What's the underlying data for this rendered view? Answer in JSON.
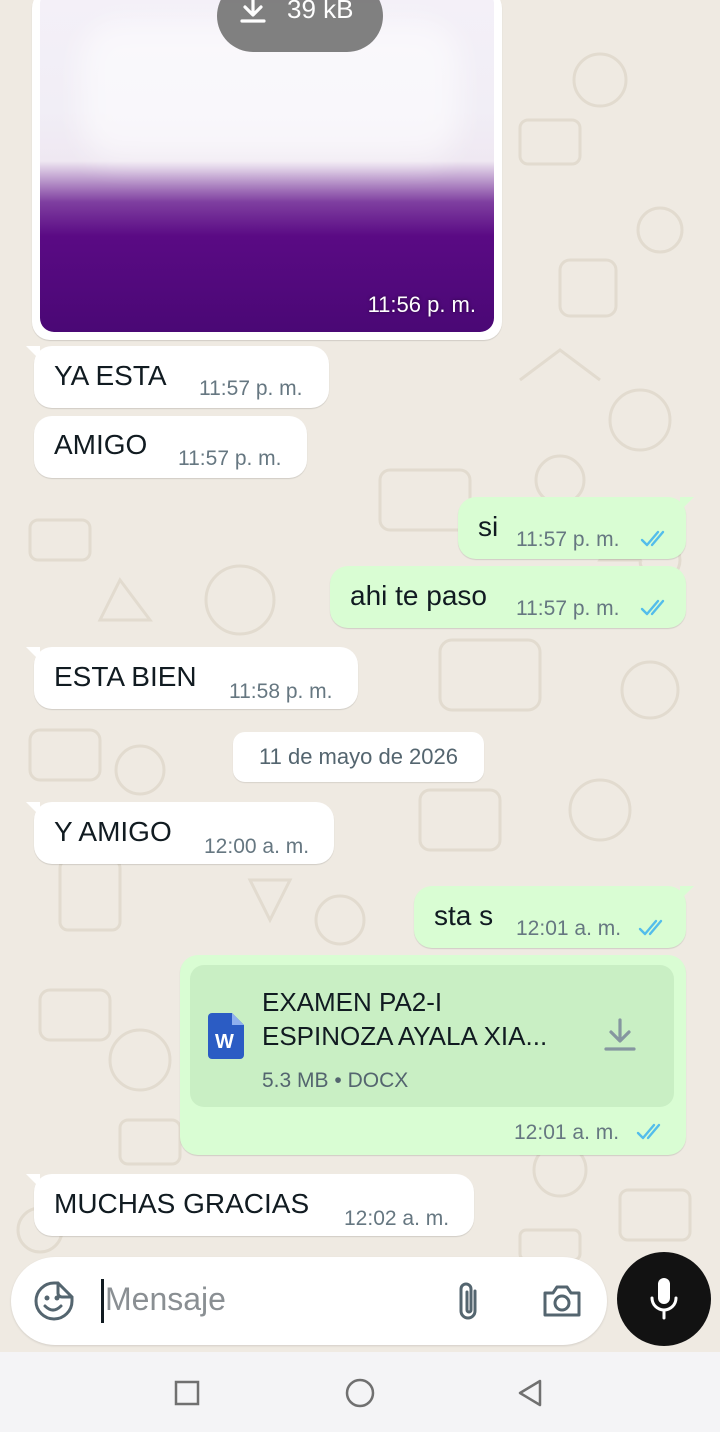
{
  "image_message": {
    "size": "39 kB",
    "time": "11:56 p. m."
  },
  "messages": [
    {
      "text": "YA ESTA",
      "time": "11:57 p. m."
    },
    {
      "text": "AMIGO",
      "time": "11:57 p. m."
    },
    {
      "text": "si",
      "time": "11:57 p. m."
    },
    {
      "text": "ahi te paso",
      "time": "11:57 p. m."
    },
    {
      "text": "ESTA BIEN",
      "time": "11:58 p. m."
    },
    {
      "text": "Y AMIGO",
      "time": "12:00 a. m."
    },
    {
      "text": "sta s",
      "time": "12:01 a. m."
    },
    {
      "text": "MUCHAS GRACIAS",
      "time": "12:02 a. m."
    }
  ],
  "date_separator": "11 de mayo de 2026",
  "document": {
    "title_line1": "EXAMEN PA2-I",
    "title_line2": "ESPINOZA AYALA XIA...",
    "size": "5.3 MB",
    "type": "DOCX",
    "icon_letter": "W",
    "time": "12:01 a. m."
  },
  "input": {
    "placeholder": "Mensaje"
  },
  "icons": {
    "sticker": "sticker-icon",
    "attach": "paperclip-icon",
    "camera": "camera-icon",
    "mic": "microphone-icon",
    "read": "double-check-icon",
    "download": "download-icon",
    "word": "word-document-icon",
    "nav": [
      "recents-square-icon",
      "home-circle-icon",
      "back-triangle-icon"
    ]
  },
  "colors": {
    "chat_background": "#efeae2",
    "incoming_bubble": "#ffffff",
    "outgoing_bubble": "#d9fdd3",
    "read_ticks": "#53bdeb",
    "word_blue": "#2b5cc4",
    "mic_button": "#121212"
  }
}
